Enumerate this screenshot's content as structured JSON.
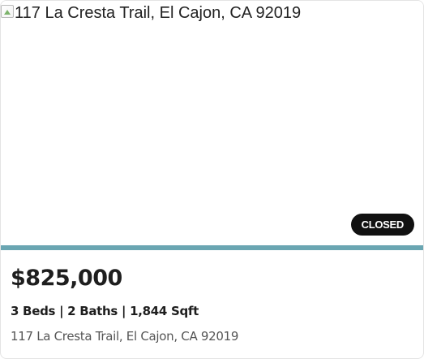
{
  "listing": {
    "image_alt": "117 La Cresta Trail, El Cajon, CA 92019",
    "status": "CLOSED",
    "price": "$825,000",
    "beds": "3 Beds",
    "baths": "2 Baths",
    "sqft": "1,844 Sqft",
    "separator": " | ",
    "address": "117 La Cresta Trail, El Cajon, CA 92019"
  },
  "colors": {
    "accent_bar": "#6aa6b2",
    "badge_bg": "#111111",
    "badge_text": "#ffffff"
  },
  "icons": {
    "broken_image": "broken-image-icon"
  }
}
